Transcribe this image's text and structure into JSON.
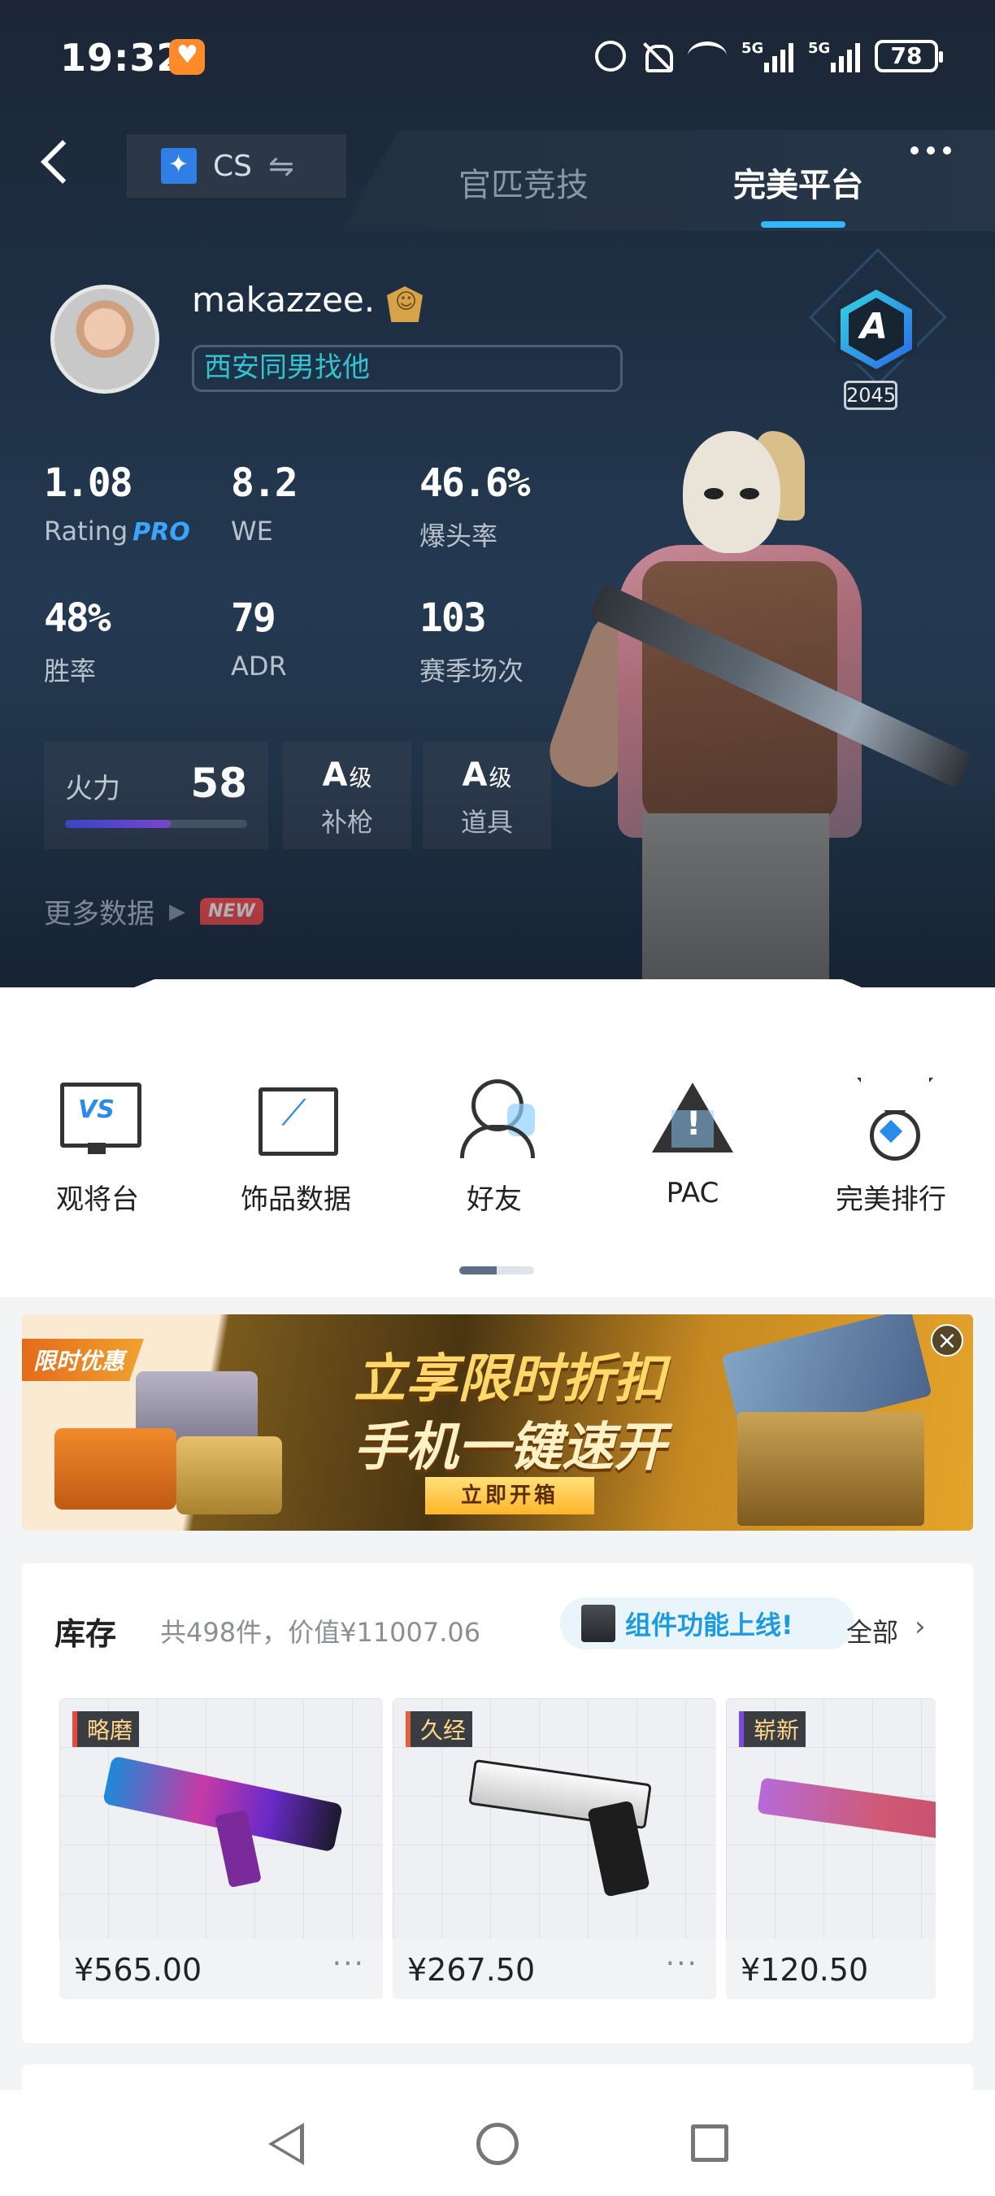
{
  "status_bar": {
    "time": "19:32",
    "battery": "78",
    "network_1": "5G",
    "network_2": "5G"
  },
  "nav": {
    "game_label": "CS",
    "tabs": [
      {
        "label": "官匹竞技",
        "active": false
      },
      {
        "label": "完美平台",
        "active": true
      }
    ]
  },
  "profile": {
    "username": "makazzee.",
    "bio": "西安同男找他",
    "rank": {
      "letter": "A",
      "score": "2045"
    }
  },
  "stats": [
    {
      "value": "1.08",
      "label": "Rating",
      "suffix": "PRO"
    },
    {
      "value": "8.2",
      "label": "WE"
    },
    {
      "value": "46.6%",
      "label": "爆头率"
    },
    {
      "value": "48%",
      "label": "胜率"
    },
    {
      "value": "79",
      "label": "ADR"
    },
    {
      "value": "103",
      "label": "赛季场次"
    }
  ],
  "firepower": {
    "label": "火力",
    "value": "58",
    "fill_percent": 58
  },
  "grades": [
    {
      "grade": "A",
      "unit": "级",
      "label": "补枪"
    },
    {
      "grade": "A",
      "unit": "级",
      "label": "道具"
    }
  ],
  "more_data": {
    "label": "更多数据",
    "badge": "NEW"
  },
  "quick_icons": [
    {
      "label": "观将台",
      "icon": "vs-monitor-icon"
    },
    {
      "label": "饰品数据",
      "icon": "chart-folder-icon"
    },
    {
      "label": "好友",
      "icon": "friend-icon"
    },
    {
      "label": "PAC",
      "icon": "pac-warning-icon"
    },
    {
      "label": "完美排行",
      "icon": "medal-icon"
    }
  ],
  "banner": {
    "flag": "限时优惠",
    "title": "立享限时折扣",
    "subtitle": "手机一键速开",
    "button": "立即开箱"
  },
  "inventory": {
    "title": "库存",
    "summary": "共498件，价值¥11007.06",
    "promo": "组件功能上线!",
    "all_label": "全部",
    "items": [
      {
        "tag": "略磨",
        "price": "¥565.00",
        "more": "···",
        "tag_color": "#e54a3a"
      },
      {
        "tag": "久经",
        "price": "¥267.50",
        "more": "···",
        "tag_color": "#e5603a"
      },
      {
        "tag": "崭新",
        "price": "¥120.50",
        "more": "",
        "tag_color": "#7a4ae6"
      }
    ]
  },
  "colors": {
    "accent": "#35b7ff",
    "hero_bg": "#1e3045",
    "link_blue": "#1c9be0",
    "bio_teal": "#33c2d0"
  }
}
